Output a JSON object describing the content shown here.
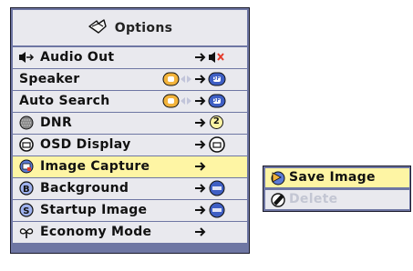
{
  "menu": {
    "title": "Options",
    "items": [
      {
        "label": "Audio Out"
      },
      {
        "label": "Speaker",
        "value": "OFF"
      },
      {
        "label": "Auto Search",
        "value": "OFF"
      },
      {
        "label": "DNR",
        "value": "2"
      },
      {
        "label": "OSD Display"
      },
      {
        "label": "Image Capture"
      },
      {
        "label": "Background"
      },
      {
        "label": "Startup Image"
      },
      {
        "label": "Economy Mode"
      }
    ]
  },
  "submenu": {
    "items": [
      {
        "label": "Save Image"
      },
      {
        "label": "Delete"
      }
    ]
  },
  "colors": {
    "panel_border": "#6e76a3",
    "row_bg": "#e9e9ee",
    "selected_bg": "#fef5a4",
    "on_badge": "#f2b33b",
    "off_badge": "#3f5fc4",
    "disabled_text": "#c3c6d3"
  }
}
